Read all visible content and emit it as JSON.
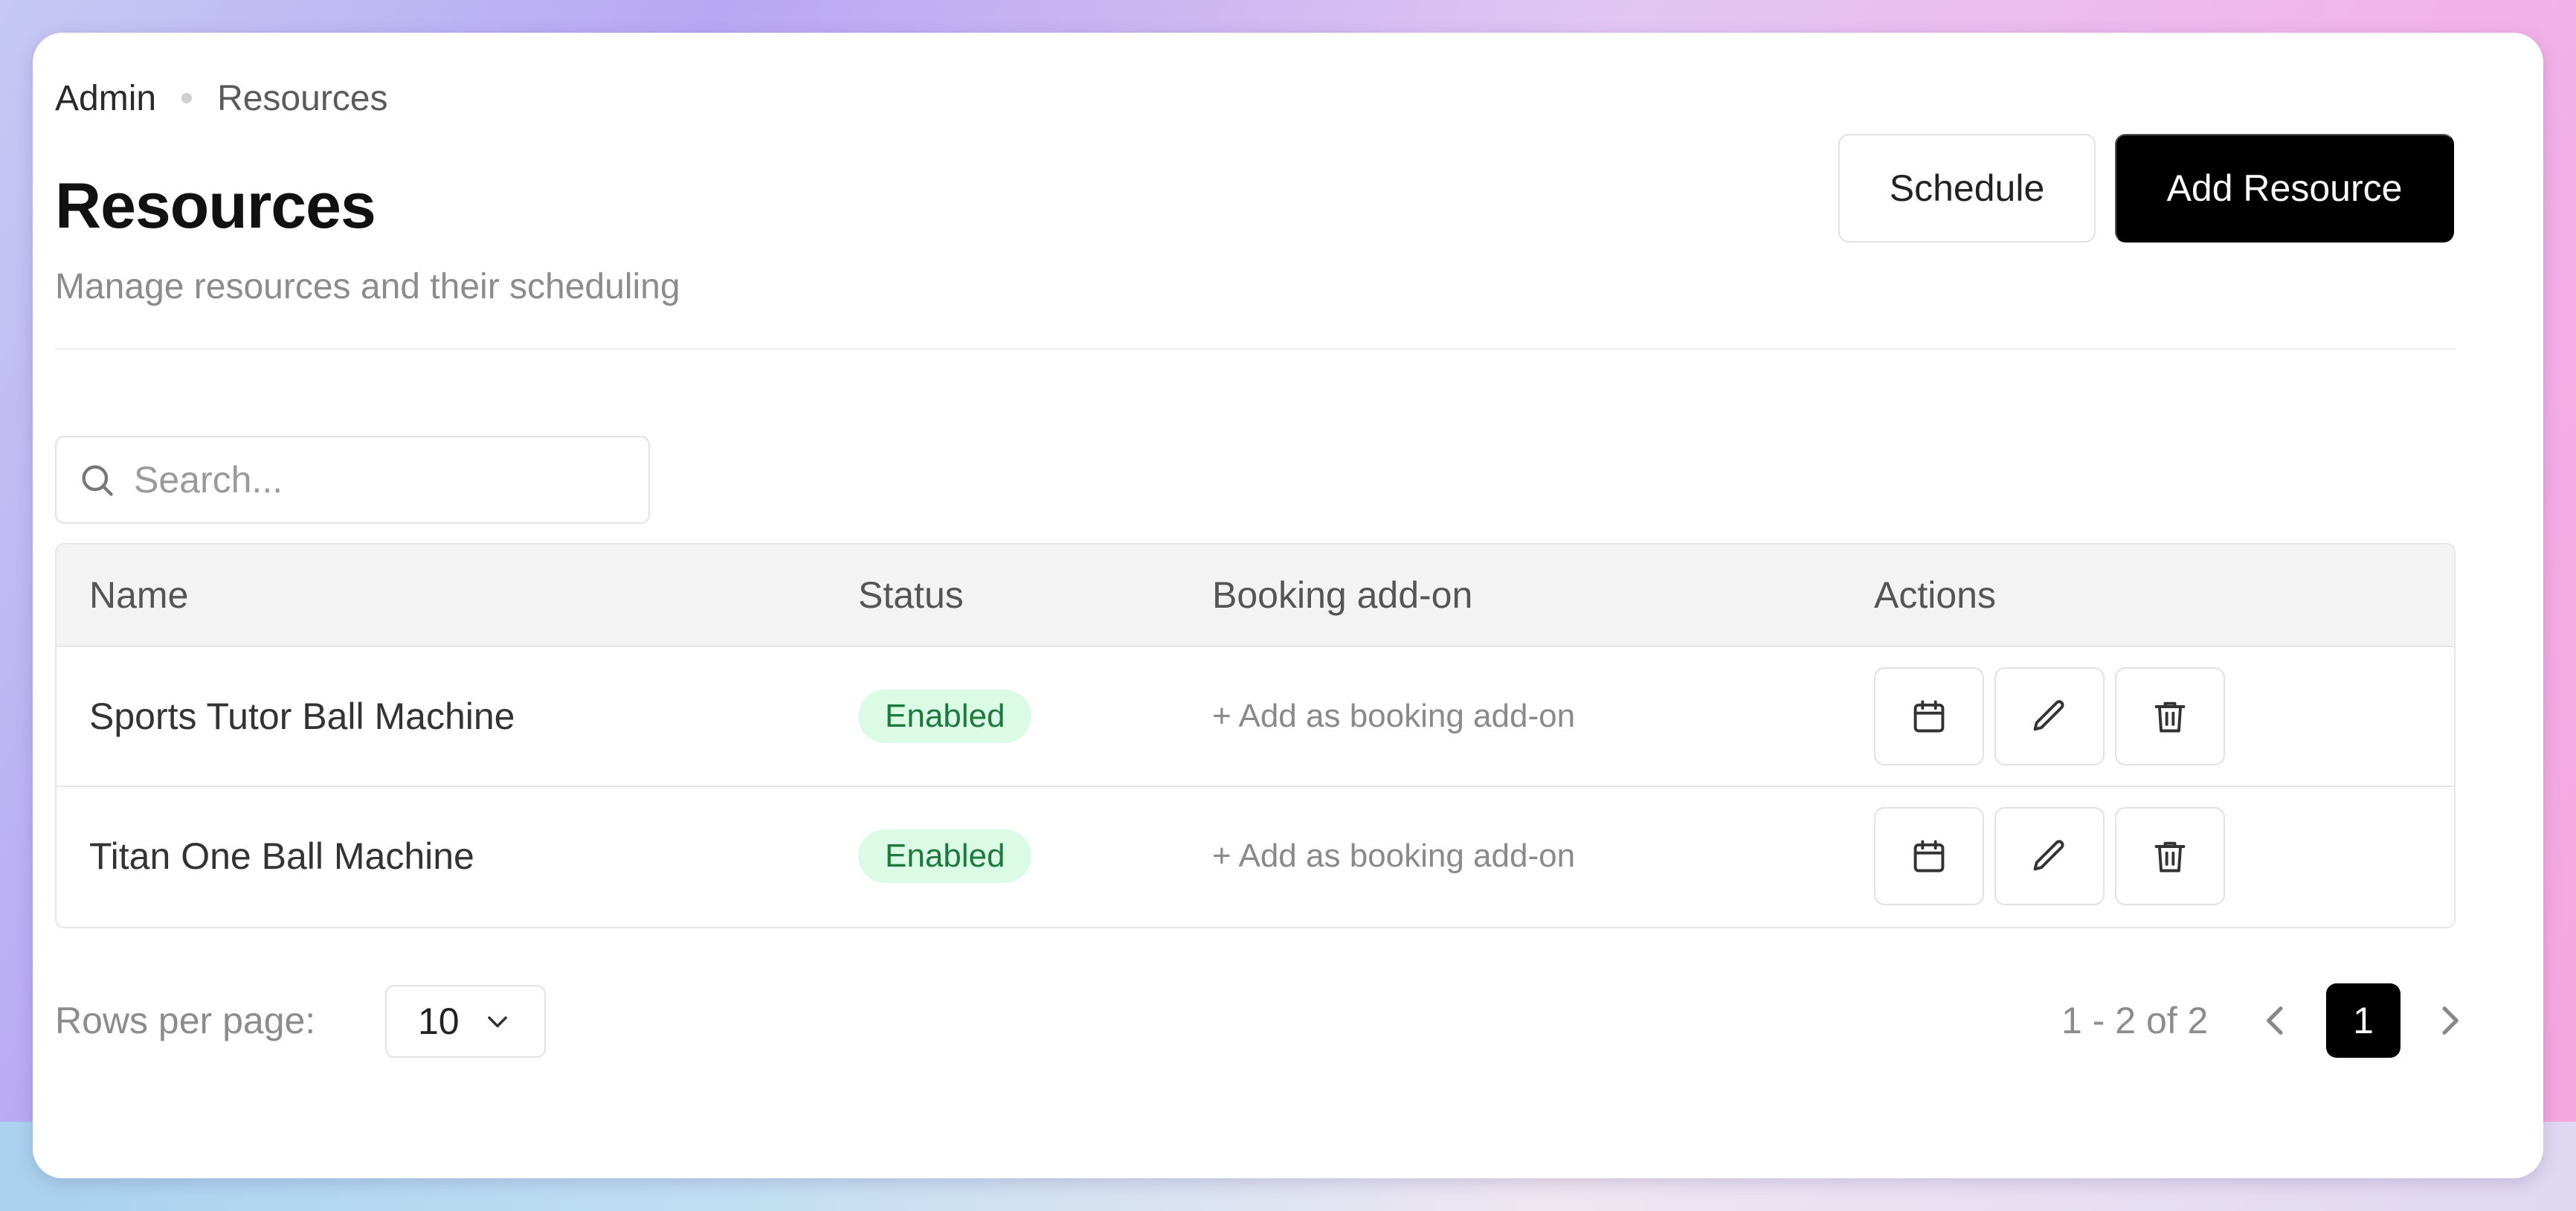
{
  "breadcrumb": {
    "root": "Admin",
    "current": "Resources"
  },
  "header": {
    "title": "Resources",
    "subtitle": "Manage resources and their scheduling",
    "schedule_label": "Schedule",
    "add_label": "Add Resource"
  },
  "search": {
    "placeholder": "Search...",
    "value": ""
  },
  "table": {
    "columns": [
      "Name",
      "Status",
      "Booking add-on",
      "Actions"
    ],
    "rows": [
      {
        "name": "Sports Tutor Ball Machine",
        "status": "Enabled",
        "addon": "+ Add as booking add-on"
      },
      {
        "name": "Titan One Ball Machine",
        "status": "Enabled",
        "addon": "+ Add as booking add-on"
      }
    ]
  },
  "pagination": {
    "rows_label": "Rows per page:",
    "rows_value": "10",
    "range": "1 - 2 of 2",
    "current_page": "1"
  },
  "colors": {
    "primary": "#000000",
    "badge_bg": "#dcfbe6",
    "badge_text": "#1d7a3e"
  },
  "icons": [
    "search-icon",
    "calendar-icon",
    "pencil-icon",
    "trash-icon",
    "chevron-down-icon",
    "chevron-left-icon",
    "chevron-right-icon"
  ]
}
